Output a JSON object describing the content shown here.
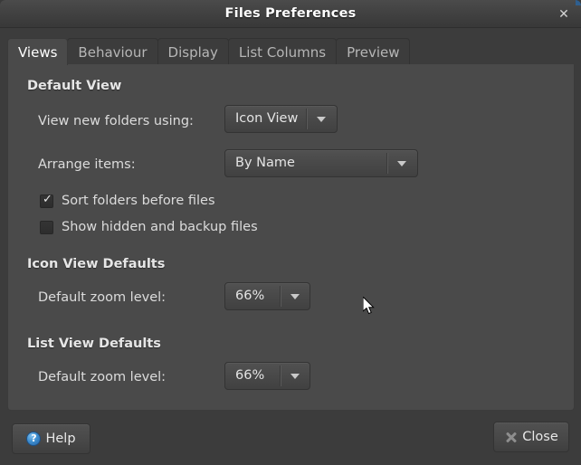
{
  "window": {
    "title": "Files Preferences",
    "close_glyph": "✕",
    "accent_color": "#2f5f8f"
  },
  "tabs": [
    {
      "label": "Views",
      "active": true
    },
    {
      "label": "Behaviour",
      "active": false
    },
    {
      "label": "Display",
      "active": false
    },
    {
      "label": "List Columns",
      "active": false
    },
    {
      "label": "Preview",
      "active": false
    }
  ],
  "sections": {
    "default_view": {
      "heading": "Default View",
      "view_new_folders_label": "View new folders using:",
      "view_new_folders_value": "Icon View",
      "arrange_items_label": "Arrange items:",
      "arrange_items_value": "By Name",
      "sort_folders_label": "Sort folders before files",
      "sort_folders_checked": true,
      "sort_folders_mark": "✓",
      "show_hidden_label": "Show hidden and backup files",
      "show_hidden_checked": false,
      "show_hidden_mark": ""
    },
    "icon_view_defaults": {
      "heading": "Icon View Defaults",
      "zoom_label": "Default zoom level:",
      "zoom_value": "66%"
    },
    "list_view_defaults": {
      "heading": "List View Defaults",
      "zoom_label": "Default zoom level:",
      "zoom_value": "66%"
    }
  },
  "buttons": {
    "help_label": "Help",
    "close_label": "Close"
  }
}
